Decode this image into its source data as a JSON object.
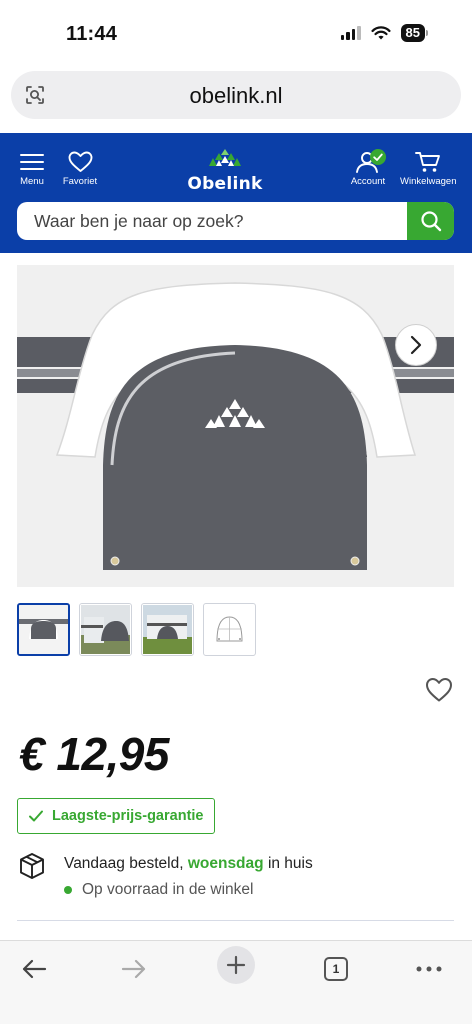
{
  "status_bar": {
    "time": "11:44",
    "battery": "85"
  },
  "browser": {
    "url": "obelink.nl",
    "tab_count": "1"
  },
  "header": {
    "menu_label": "Menu",
    "favorites_label": "Favoriet",
    "logo_text": "Obelink",
    "account_label": "Account",
    "cart_label": "Winkelwagen",
    "brand_color": "#0b3fa8",
    "accent_color": "#38a832"
  },
  "search": {
    "placeholder": "Waar ben je naar op zoek?"
  },
  "product": {
    "price": "€ 12,95",
    "guarantee_label": "Laagste-prijs-garantie",
    "delivery_prefix": "Vandaag besteld,",
    "delivery_day": "woensdag",
    "delivery_suffix": "in huis",
    "stock_status": "Op voorraad in de winkel",
    "thumbnails": [
      "thumb-1",
      "thumb-2",
      "thumb-3",
      "thumb-4"
    ]
  },
  "icons": [
    "lens-icon",
    "menu-icon",
    "heart-icon",
    "account-icon",
    "cart-icon",
    "search-icon",
    "chevron-right-icon",
    "check-icon",
    "box-icon",
    "back-icon",
    "forward-icon",
    "plus-icon",
    "tabs-icon",
    "more-icon"
  ]
}
